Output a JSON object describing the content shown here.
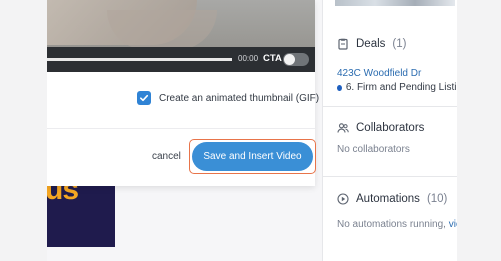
{
  "video": {
    "time": "00:00",
    "cta_label": "CTA",
    "progress_percent": 100,
    "cta_enabled": false
  },
  "gif_option": {
    "label": "Create an animated thumbnail (GIF)",
    "checked": true
  },
  "actions": {
    "cancel_label": "cancel",
    "save_label": "Save and Insert Video"
  },
  "background": {
    "promo_text": "us",
    "deals": {
      "title": "Deals",
      "count": "(1)",
      "address": "423C Woodfield Dr",
      "stage": "6. Firm and Pending Listin"
    },
    "collaborators": {
      "title": "Collaborators",
      "empty": "No collaborators"
    },
    "automations": {
      "title": "Automations",
      "count": "(10)",
      "status": "No automations running,",
      "link": "vie"
    }
  },
  "colors": {
    "primary": "#3a8fd6",
    "highlight_outline": "#e8744a",
    "checkbox": "#2f83d5",
    "promo_bg": "#1f1b4d",
    "promo_text": "#f4a623"
  }
}
